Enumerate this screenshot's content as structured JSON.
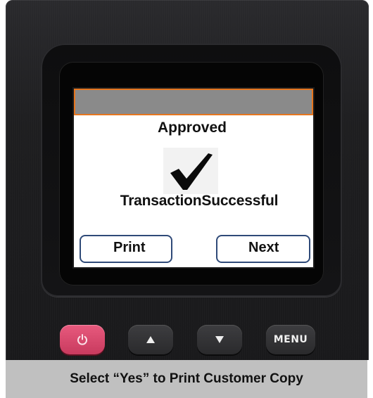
{
  "screen": {
    "status_text": "Approved",
    "icon": "checkmark-icon",
    "message": "TransactionSuccessful",
    "buttons": {
      "print_label": "Print",
      "next_label": "Next"
    },
    "header_border_color": "#e6761f",
    "header_fill_color": "#8a8a8a"
  },
  "hardware_keys": {
    "power_icon": "power-icon",
    "up_icon": "up-arrow-icon",
    "down_icon": "down-arrow-icon",
    "menu_label": "MENU",
    "power_color": "#e04a70"
  },
  "caption": {
    "text": "Select “Yes” to Print Customer Copy"
  }
}
